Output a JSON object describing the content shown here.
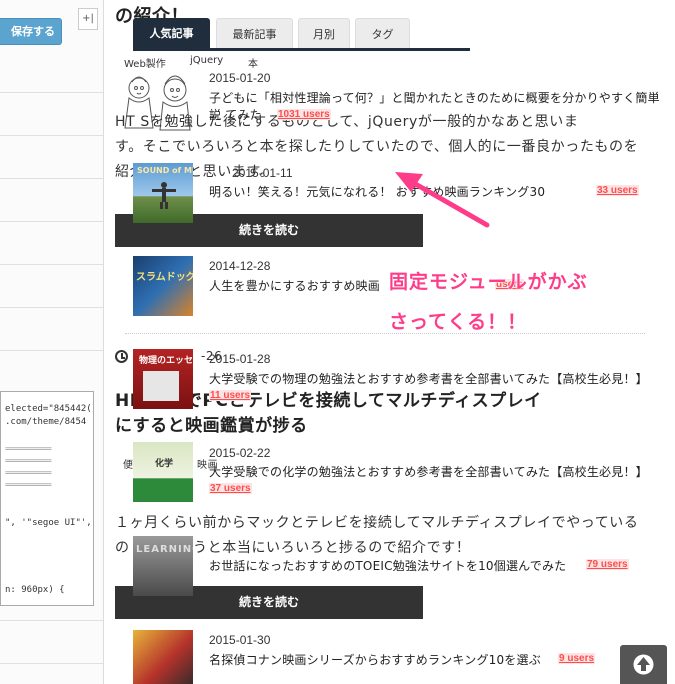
{
  "editor": {
    "save_label": "保存する",
    "collapse_label": "+|",
    "code_lines": [
      "elected=\"845442(",
      ".com/theme/8454",
      "\", '\"segoe UI\"', '\"b",
      "n: 960px) {"
    ],
    "code_dashes": "============"
  },
  "article": {
    "title_top": "の紹介！",
    "para1_line1": "HT    Sを勉強した後にするものとして、jQueryが一般的かなあと思いま",
    "para1_line2": "す。そこでいろいろと本を探したりしていたので、個人的に一番良かったものを",
    "para1_line3": "紹介しようと思います。",
    "readmore_label": "続きを読む",
    "date2": "-26",
    "title2_line1": "HD     ーンでPCとテレビを接続してマルチディスプレイ",
    "title2_line2": "にすると映画鑑賞が捗る",
    "tags2_left": "便",
    "tags2_right": "映画",
    "para2_line1": "１ヶ月くらい前からマックとテレビを接続してマルチディスプレイでやっている",
    "para2_line2": "の    これを使うと本当にいろいろと捗るので紹介です！",
    "readmore2_label": "続きを読む"
  },
  "widget": {
    "tabs": [
      "人気記事",
      "最新記事",
      "月別",
      "タグ"
    ],
    "categories": [
      "Web製作",
      "jQuery",
      "本"
    ],
    "posts": [
      {
        "date": "2015-01-20",
        "title": "子どもに「相対性理論って何？」と聞かれたときのために概要を分かりやすく簡単",
        "title2": "説    てみた",
        "users": "1031 users"
      },
      {
        "date": "2015-01-11",
        "title": "明るい！笑える！元気になれる！      おすすめ映画ランキング30",
        "users": "33 users"
      },
      {
        "date": "2014-12-28",
        "title": "人生を豊かにするおすすめ映画",
        "users": "users"
      },
      {
        "date": "2015-01-28",
        "title": "大学受験での物理の勉強法とおすすめ参考書を全部書いてみた【高校生必見！】",
        "users": "11 users"
      },
      {
        "date": "2015-02-22",
        "title": "大学受験での化学の勉強法とおすすめ参考書を全部書いてみた【高校生必見！】",
        "users": "37 users"
      },
      {
        "date": "",
        "title": "お世話になったおすすめのTOEIC勉強法サイトを10個選んでみた",
        "users": "79 users"
      },
      {
        "date": "2015-01-30",
        "title": "名探偵コナン映画シリーズからおすすめランキング10を選ぶ",
        "users": "9 users"
      }
    ],
    "thumbs": [
      "SOUND of MUSIC",
      "スラムドッグ ミリオネア",
      "物理のエッセンス",
      "化学",
      "LEARNING"
    ]
  },
  "annotation": {
    "line1": "固定モジュールがかぶ",
    "line2": "さってくる！！"
  },
  "colors": {
    "accent_pink": "#ff3c8a",
    "tab_dark": "#1f2d3d",
    "users_red": "#ff4d4d",
    "save_blue": "#5ba4cf"
  }
}
